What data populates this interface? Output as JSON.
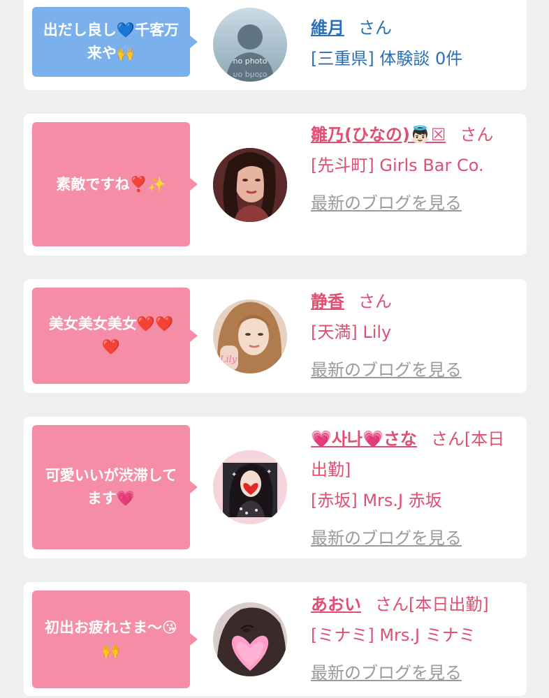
{
  "entries": [
    {
      "message": "出だし良し💙千客万来や🙌",
      "name": "維月",
      "suffix": "さん",
      "shop": "[三重県] 体験談 0件",
      "blog_link": "",
      "avatar_label": "no photo",
      "avatar_label2": "no photo"
    },
    {
      "message": "素敵ですね❣️✨",
      "name": "雛乃(ひなの)👼🏻☒",
      "suffix": "さん",
      "shop": "[先斗町] Girls Bar Co.",
      "blog_link": "最新のブログを見る"
    },
    {
      "message": "美女美女美女❤️❤️❤️",
      "name": "静香",
      "suffix": "さん",
      "shop": "[天満] Lily",
      "blog_link": "最新のブログを見る",
      "avatar_text": "Lily"
    },
    {
      "message": "可愛いいが渋滞してます💗",
      "name": "💗사나💗さな",
      "suffix": "さん[本日出勤]",
      "shop": "[赤坂] Mrs.J 赤坂",
      "blog_link": "最新のブログを見る"
    },
    {
      "message": "初出お疲れさま〜😘🙌",
      "name": "あおい",
      "suffix": "さん[本日出勤]",
      "shop": "[ミナミ] Mrs.J ミナミ",
      "blog_link": "最新のブログを見る"
    }
  ],
  "colors": {
    "blue_accent": "#2a6fb8",
    "pink_accent": "#e04e71",
    "blue_bubble": "#7ab0ec",
    "pink_bubble": "#f58da6",
    "background": "#efeff0"
  }
}
